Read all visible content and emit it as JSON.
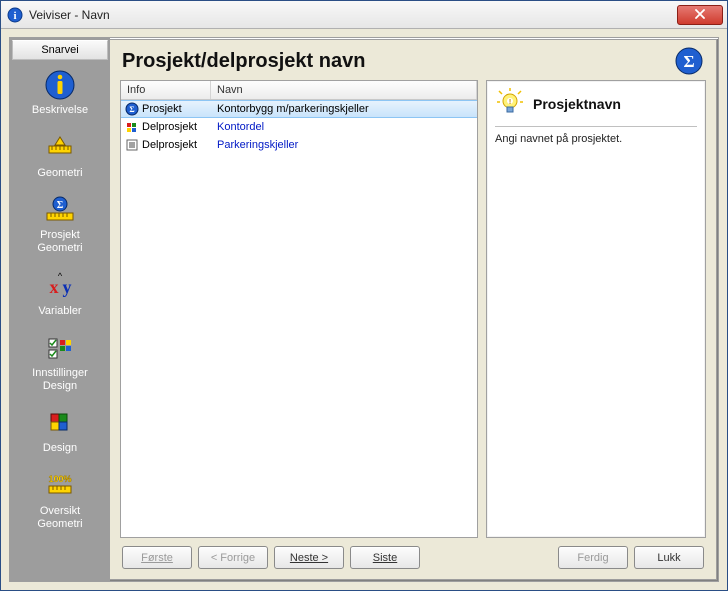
{
  "window": {
    "title": "Veiviser - Navn"
  },
  "sidebar": {
    "header": "Snarvei",
    "items": [
      {
        "label": "Beskrivelse",
        "icon": "info-icon"
      },
      {
        "label": "Geometri",
        "icon": "ruler-icon"
      },
      {
        "label": "Prosjekt\nGeometri",
        "icon": "ruler-sigma-icon"
      },
      {
        "label": "Variabler",
        "icon": "xy-icon"
      },
      {
        "label": "Innstillinger\nDesign",
        "icon": "checklist-icon"
      },
      {
        "label": "Design",
        "icon": "cube-icon"
      },
      {
        "label": "Oversikt\nGeometri",
        "icon": "ruler-100-icon"
      }
    ]
  },
  "content": {
    "title": "Prosjekt/delprosjekt navn",
    "columns": {
      "info": "Info",
      "navn": "Navn"
    },
    "rows": [
      {
        "info": "Prosjekt",
        "navn": "Kontorbygg m/parkeringskjeller",
        "selected": true,
        "icon": "sigma-mini-icon"
      },
      {
        "info": "Delprosjekt",
        "navn": "Kontordel",
        "selected": false,
        "icon": "subproject-mini-icon"
      },
      {
        "info": "Delprosjekt",
        "navn": "Parkeringskjeller",
        "selected": false,
        "icon": "subproject-list-mini-icon"
      }
    ]
  },
  "hint": {
    "title": "Prosjektnavn",
    "body": "Angi navnet på prosjektet."
  },
  "buttons": {
    "forste": "Første",
    "forrige": "< Forrige",
    "neste": "Neste >",
    "siste": "Siste",
    "ferdig": "Ferdig",
    "lukk": "Lukk"
  }
}
